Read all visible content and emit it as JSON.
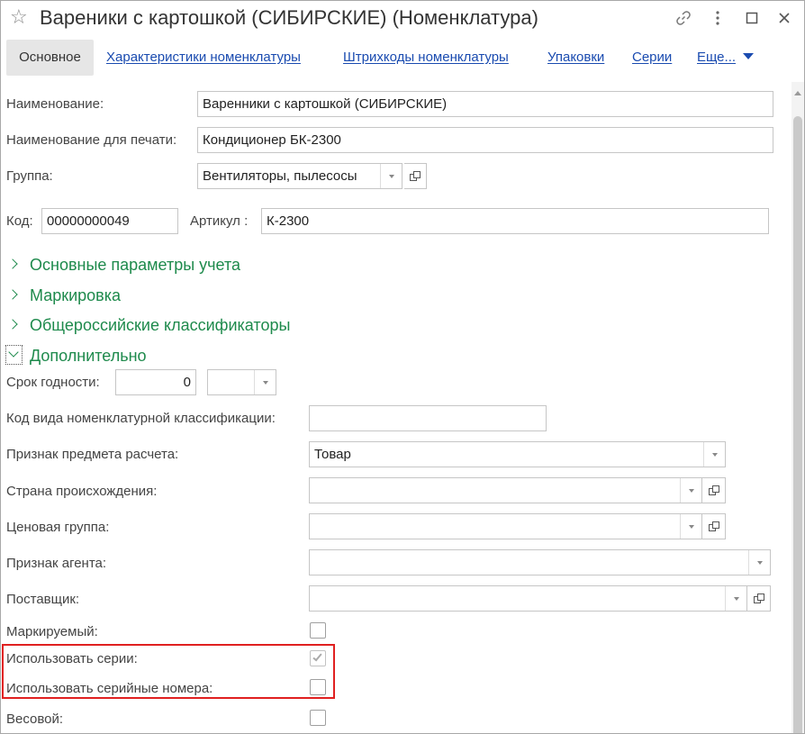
{
  "window": {
    "title": "Вареники с картошкой (СИБИРСКИЕ) (Номенклатура)",
    "icons": [
      "star-icon",
      "link-icon",
      "more-vertical-icon",
      "maximize-icon",
      "close-icon"
    ]
  },
  "tabs": {
    "main": "Основное",
    "characteristics": "Характеристики номенклатуры",
    "barcodes": "Штрихкоды номенклатуры",
    "packages": "Упаковки",
    "series": "Серии",
    "more": "Еще..."
  },
  "form": {
    "name_label": "Наименование:",
    "name_value": "Варенники с картошкой (СИБИРСКИЕ)",
    "print_name_label": "Наименование для печати:",
    "print_name_value": "Кондиционер БК-2300",
    "group_label": "Группа:",
    "group_value": "Вентиляторы, пылесосы",
    "code_label": "Код:",
    "code_value": "00000000049",
    "article_label": "Артикул :",
    "article_value": "К-2300"
  },
  "sections": {
    "main_params": "Основные параметры учета",
    "marking": "Маркировка",
    "classifiers": "Общероссийские классификаторы",
    "additional": "Дополнительно"
  },
  "additional": {
    "shelf_life_label": "Срок годности:",
    "shelf_life_value": "0",
    "shelf_life_unit": "",
    "classification_code_label": "Код вида номенклатурной классификации:",
    "classification_code_value": "",
    "payment_subject_label": "Признак предмета расчета:",
    "payment_subject_value": "Товар",
    "country_label": "Страна происхождения:",
    "country_value": "",
    "price_group_label": "Ценовая группа:",
    "price_group_value": "",
    "agent_label": "Признак агента:",
    "agent_value": "",
    "supplier_label": "Поставщик:",
    "supplier_value": "",
    "marked_label": "Маркируемый:",
    "marked_checked": false,
    "use_series_label": "Использовать серии:",
    "use_series_checked": true,
    "use_serials_label": "Использовать серийные номера:",
    "use_serials_checked": false,
    "weighted_label": "Весовой:",
    "weighted_checked": false
  },
  "colors": {
    "section_green": "#1e8a4c",
    "link_blue": "#1a4bb0",
    "highlight_red": "#e02020"
  }
}
